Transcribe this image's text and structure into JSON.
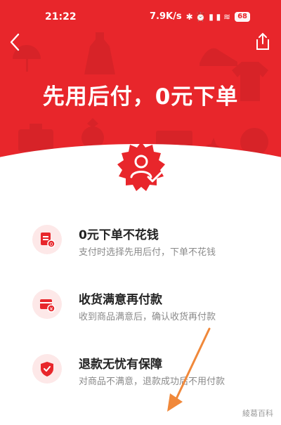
{
  "status_bar": {
    "time": "21:22",
    "speed": "7.9K/s",
    "glyphs": "✱ ⏰ ▮ ▮ ≋",
    "battery": "68"
  },
  "icons": {
    "back": "chevron-left-icon",
    "share": "share-icon",
    "badge": "user-shield-badge-icon"
  },
  "hero": {
    "title": "先用后付，0元下单",
    "color": "#e8262b"
  },
  "features": [
    {
      "icon": "document-coin-icon",
      "title": "0元下单不花钱",
      "desc": "支付时选择先用后付，下单不花钱"
    },
    {
      "icon": "box-coin-icon",
      "title": "收货满意再付款",
      "desc": "收到商品满意后，确认收货再付款"
    },
    {
      "icon": "shield-check-icon",
      "title": "退款无忧有保障",
      "desc": "对商品不满意，退款成功后不用付款"
    }
  ],
  "watermark": "綾葛百科",
  "colors": {
    "accent": "#e8262b",
    "icon_bg": "#fde8e8",
    "arrow": "#f0883a"
  }
}
